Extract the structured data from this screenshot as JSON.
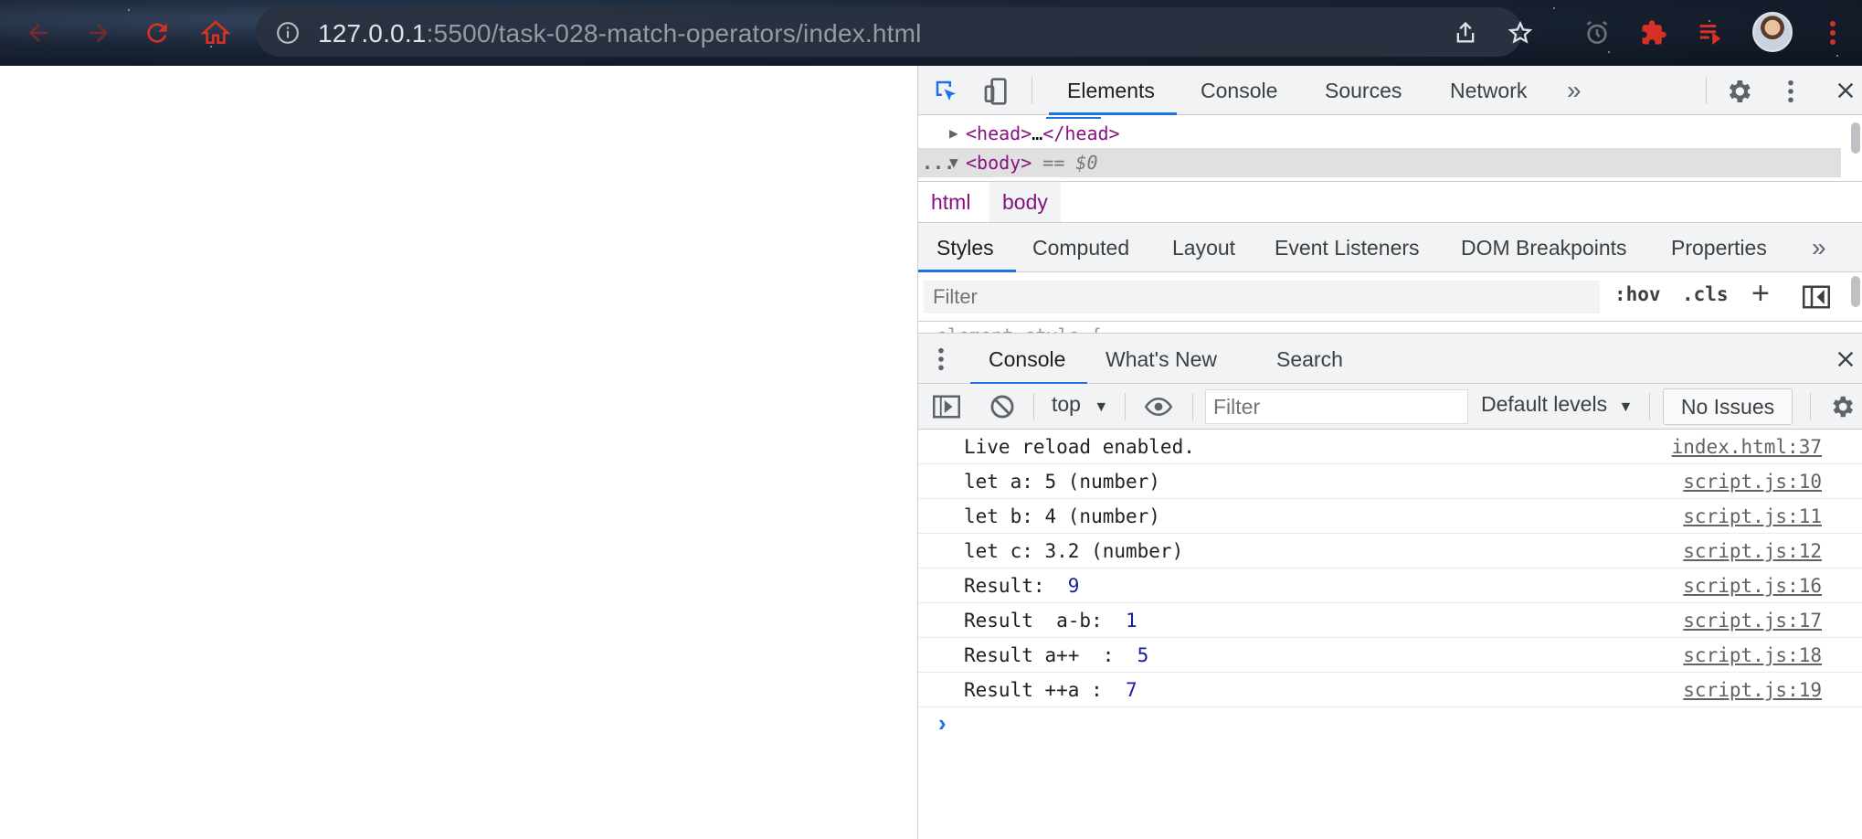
{
  "browser": {
    "url_host": "127.0.0.1",
    "url_rest": ":5500/task-028-match-operators/index.html",
    "icons": [
      "back-arrow-icon",
      "forward-arrow-icon",
      "reload-icon",
      "home-icon",
      "info-icon",
      "share-icon",
      "star-icon",
      "alarm-icon",
      "puzzle-extension-icon",
      "reading-list-icon",
      "avatar",
      "more-vert-icon"
    ]
  },
  "devtools": {
    "tabs": [
      "Elements",
      "Console",
      "Sources",
      "Network"
    ],
    "more_tabs": "»",
    "dom": {
      "head_open": "<head>",
      "head_ellipsis": "…",
      "head_close": "</head>",
      "body_open": "<body>",
      "body_marker": "== $0",
      "row_dots": "..."
    },
    "breadcrumbs": [
      "html",
      "body"
    ],
    "sub_tabs": [
      "Styles",
      "Computed",
      "Layout",
      "Event Listeners",
      "DOM Breakpoints",
      "Properties"
    ],
    "styles_filter_placeholder": "Filter",
    "hov": ":hov",
    "cls": ".cls",
    "plus": "+",
    "clipped_rule": "element.style {"
  },
  "drawer": {
    "tabs": [
      "Console",
      "What's New",
      "Search"
    ],
    "context": "top",
    "filter_placeholder": "Filter",
    "levels": "Default levels",
    "issues": "No Issues",
    "messages": [
      {
        "text": "Live reload enabled.",
        "num": "",
        "source": "index.html:37"
      },
      {
        "text": "let a: 5 (number)",
        "num": "",
        "source": "script.js:10"
      },
      {
        "text": "let b: 4 (number)",
        "num": "",
        "source": "script.js:11"
      },
      {
        "text": "let c: 3.2 (number)",
        "num": "",
        "source": "script.js:12"
      },
      {
        "text": "Result:  ",
        "num": "9",
        "source": "script.js:16"
      },
      {
        "text": "Result  a-b:  ",
        "num": "1",
        "source": "script.js:17"
      },
      {
        "text": "Result a++  :  ",
        "num": "5",
        "source": "script.js:18"
      },
      {
        "text": "Result ++a :  ",
        "num": "7",
        "source": "script.js:19"
      }
    ],
    "prompt": "›"
  },
  "colors": {
    "accent": "#1a73e8",
    "tag": "#881280",
    "number": "#1a1aa6",
    "ext_red": "#d93025"
  }
}
